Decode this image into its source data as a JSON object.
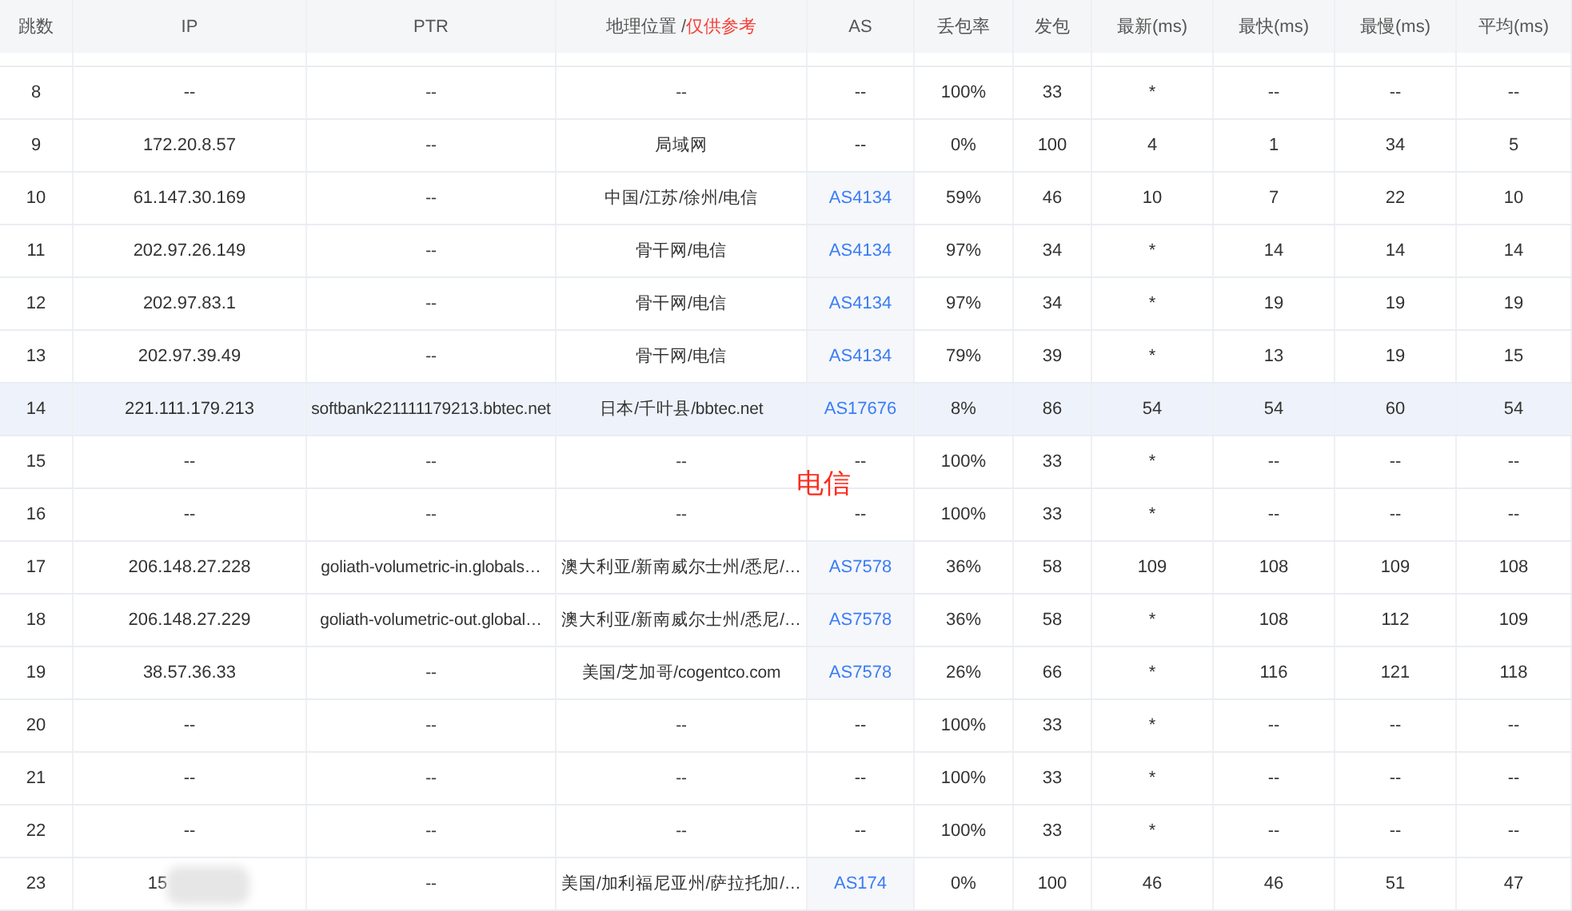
{
  "table": {
    "columns": [
      {
        "label": "跳数"
      },
      {
        "label": "IP"
      },
      {
        "label": "PTR"
      },
      {
        "label": "地理位置 / ",
        "note": "仅供参考"
      },
      {
        "label": "AS"
      },
      {
        "label": "丢包率"
      },
      {
        "label": "发包"
      },
      {
        "label": "最新(ms)"
      },
      {
        "label": "最快(ms)"
      },
      {
        "label": "最慢(ms)"
      },
      {
        "label": "平均(ms)"
      }
    ],
    "rows": [
      {
        "hop": "8",
        "ip": "--",
        "ptr": "--",
        "geo": "--",
        "as": "--",
        "as_link": false,
        "loss": "100%",
        "sent": "33",
        "last": "*",
        "best": "--",
        "worst": "--",
        "avg": "--",
        "highlighted": false
      },
      {
        "hop": "9",
        "ip": "172.20.8.57",
        "ptr": "--",
        "geo": "局域网",
        "as": "--",
        "as_link": false,
        "loss": "0%",
        "sent": "100",
        "last": "4",
        "best": "1",
        "worst": "34",
        "avg": "5",
        "highlighted": false
      },
      {
        "hop": "10",
        "ip": "61.147.30.169",
        "ptr": "--",
        "geo": "中国/江苏/徐州/电信",
        "as": "AS4134",
        "as_link": true,
        "loss": "59%",
        "sent": "46",
        "last": "10",
        "best": "7",
        "worst": "22",
        "avg": "10",
        "highlighted": false
      },
      {
        "hop": "11",
        "ip": "202.97.26.149",
        "ptr": "--",
        "geo": "骨干网/电信",
        "as": "AS4134",
        "as_link": true,
        "loss": "97%",
        "sent": "34",
        "last": "*",
        "best": "14",
        "worst": "14",
        "avg": "14",
        "highlighted": false
      },
      {
        "hop": "12",
        "ip": "202.97.83.1",
        "ptr": "--",
        "geo": "骨干网/电信",
        "as": "AS4134",
        "as_link": true,
        "loss": "97%",
        "sent": "34",
        "last": "*",
        "best": "19",
        "worst": "19",
        "avg": "19",
        "highlighted": false
      },
      {
        "hop": "13",
        "ip": "202.97.39.49",
        "ptr": "--",
        "geo": "骨干网/电信",
        "as": "AS4134",
        "as_link": true,
        "loss": "79%",
        "sent": "39",
        "last": "*",
        "best": "13",
        "worst": "19",
        "avg": "15",
        "highlighted": false
      },
      {
        "hop": "14",
        "ip": "221.111.179.213",
        "ptr": "softbank221111179213.bbtec.net",
        "geo": "日本/千叶县/bbtec.net",
        "as": "AS17676",
        "as_link": true,
        "loss": "8%",
        "sent": "86",
        "last": "54",
        "best": "54",
        "worst": "60",
        "avg": "54",
        "highlighted": true
      },
      {
        "hop": "15",
        "ip": "--",
        "ptr": "--",
        "geo": "--",
        "as": "--",
        "as_link": false,
        "loss": "100%",
        "sent": "33",
        "last": "*",
        "best": "--",
        "worst": "--",
        "avg": "--",
        "highlighted": false
      },
      {
        "hop": "16",
        "ip": "--",
        "ptr": "--",
        "geo": "--",
        "as": "--",
        "as_link": false,
        "loss": "100%",
        "sent": "33",
        "last": "*",
        "best": "--",
        "worst": "--",
        "avg": "--",
        "highlighted": false
      },
      {
        "hop": "17",
        "ip": "206.148.27.228",
        "ptr": "goliath-volumetric-in.globals…",
        "geo": "澳大利亚/新南威尔士州/悉尼/…",
        "as": "AS7578",
        "as_link": true,
        "loss": "36%",
        "sent": "58",
        "last": "109",
        "best": "108",
        "worst": "109",
        "avg": "108",
        "highlighted": false
      },
      {
        "hop": "18",
        "ip": "206.148.27.229",
        "ptr": "goliath-volumetric-out.global…",
        "geo": "澳大利亚/新南威尔士州/悉尼/…",
        "as": "AS7578",
        "as_link": true,
        "loss": "36%",
        "sent": "58",
        "last": "*",
        "best": "108",
        "worst": "112",
        "avg": "109",
        "highlighted": false
      },
      {
        "hop": "19",
        "ip": "38.57.36.33",
        "ptr": "--",
        "geo": "美国/芝加哥/cogentco.com",
        "as": "AS7578",
        "as_link": true,
        "loss": "26%",
        "sent": "66",
        "last": "*",
        "best": "116",
        "worst": "121",
        "avg": "118",
        "highlighted": false
      },
      {
        "hop": "20",
        "ip": "--",
        "ptr": "--",
        "geo": "--",
        "as": "--",
        "as_link": false,
        "loss": "100%",
        "sent": "33",
        "last": "*",
        "best": "--",
        "worst": "--",
        "avg": "--",
        "highlighted": false
      },
      {
        "hop": "21",
        "ip": "--",
        "ptr": "--",
        "geo": "--",
        "as": "--",
        "as_link": false,
        "loss": "100%",
        "sent": "33",
        "last": "*",
        "best": "--",
        "worst": "--",
        "avg": "--",
        "highlighted": false
      },
      {
        "hop": "22",
        "ip": "--",
        "ptr": "--",
        "geo": "--",
        "as": "--",
        "as_link": false,
        "loss": "100%",
        "sent": "33",
        "last": "*",
        "best": "--",
        "worst": "--",
        "avg": "--",
        "highlighted": false
      },
      {
        "hop": "23",
        "ip": "15",
        "ip_redacted": true,
        "ptr": "--",
        "geo": "美国/加利福尼亚州/萨拉托加/…",
        "as": "AS174",
        "as_link": true,
        "loss": "0%",
        "sent": "100",
        "last": "46",
        "best": "46",
        "worst": "51",
        "avg": "47",
        "highlighted": false
      }
    ]
  },
  "annotation": {
    "text": "电信",
    "color": "#ff2a1a"
  }
}
